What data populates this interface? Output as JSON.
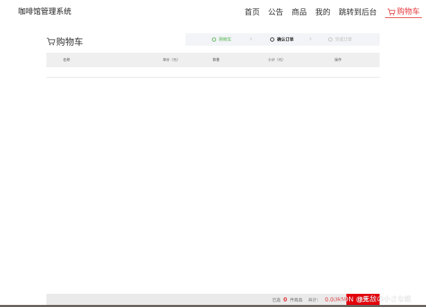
{
  "header": {
    "brand": "咖啡馆管理系统",
    "nav": [
      {
        "label": "首页"
      },
      {
        "label": "公告"
      },
      {
        "label": "商品"
      },
      {
        "label": "我的"
      },
      {
        "label": "跳转到后台"
      },
      {
        "label": "购物车",
        "active": true
      }
    ]
  },
  "cart": {
    "title": "购物车",
    "steps": [
      {
        "label": "购物车",
        "state": "done"
      },
      {
        "label": "确认订单",
        "state": "current"
      },
      {
        "label": "完成订单",
        "state": "pending"
      }
    ],
    "columns": [
      "名称",
      "单价（元）",
      "数量",
      "小计（元）",
      "操作"
    ],
    "rows": []
  },
  "footer": {
    "selected_prefix": "已选",
    "selected_count": "0",
    "selected_suffix": "件商品",
    "total_label": "共计：",
    "total_amount": "0.00RMB",
    "settle_label": "结算"
  },
  "watermark": "CSDN @无敌の小さな蚁",
  "colors": {
    "accent": "#e4393c",
    "step_done": "#4cb44c",
    "settle_button": "#e4000b"
  }
}
